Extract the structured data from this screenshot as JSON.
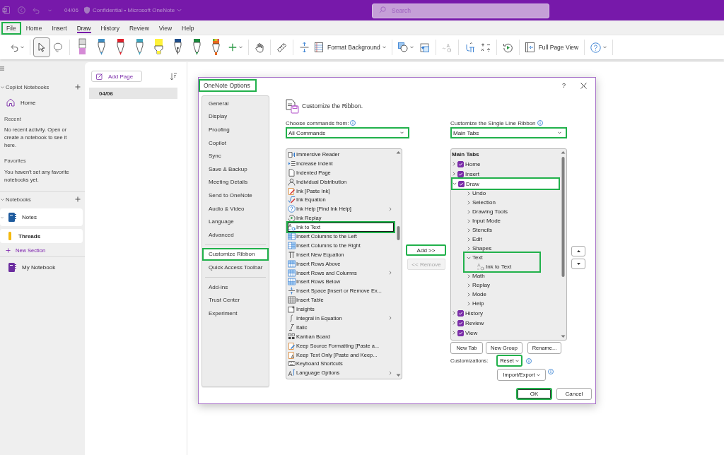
{
  "titlebar": {
    "date": "04/06",
    "title": "Confidential • Microsoft OneNote",
    "search": {
      "placeholder": "Search"
    }
  },
  "menu": [
    {
      "label": "File",
      "selected": false,
      "highlighted": true
    },
    {
      "label": "Home",
      "selected": false,
      "highlighted": false
    },
    {
      "label": "Insert",
      "selected": false,
      "highlighted": false
    },
    {
      "label": "Draw",
      "selected": true,
      "highlighted": false
    },
    {
      "label": "History",
      "selected": false,
      "highlighted": false
    },
    {
      "label": "Review",
      "selected": false,
      "highlighted": false
    },
    {
      "label": "View",
      "selected": false,
      "highlighted": false
    },
    {
      "label": "Help",
      "selected": false,
      "highlighted": false
    }
  ],
  "toolbar": {
    "groups": [
      [
        {
          "kind": "undo"
        }
      ],
      [
        {
          "kind": "pointer",
          "selected": true
        },
        {
          "kind": "lasso",
          "selected": false
        }
      ],
      [
        {
          "kind": "eraser",
          "color": "#d58ad6"
        },
        {
          "kind": "pen",
          "color": "#3f8fc4"
        },
        {
          "kind": "pen",
          "color": "#e3202b"
        },
        {
          "kind": "pen",
          "color": "#41a6bf"
        },
        {
          "kind": "highlighter",
          "color": "#fff23a"
        },
        {
          "kind": "fountain",
          "color": "#1f4e8c"
        },
        {
          "kind": "pen",
          "color": "#1c8a3e"
        },
        {
          "kind": "rainbow",
          "color": "#e8681e"
        },
        {
          "kind": "add-pen"
        }
      ],
      [
        {
          "kind": "hand"
        }
      ],
      [
        {
          "kind": "ruler"
        }
      ],
      [
        {
          "kind": "insert-space"
        },
        {
          "kind": "format-background",
          "label": "Format Background"
        }
      ],
      [
        {
          "kind": "shapes"
        },
        {
          "kind": "ink-to-shape"
        }
      ],
      [
        {
          "kind": "ink-to-text",
          "disabled": true
        }
      ],
      [
        {
          "kind": "ink-to-math"
        },
        {
          "kind": "math"
        }
      ],
      [
        {
          "kind": "replay"
        }
      ],
      [
        {
          "kind": "full-page",
          "label": "Full Page View"
        }
      ],
      [
        {
          "kind": "help"
        }
      ]
    ]
  },
  "sidebar": {
    "copilot": {
      "title": "Copilot Notebooks",
      "expanded": true,
      "home": "Home"
    },
    "recent": {
      "heading": "Recent",
      "text": "No recent activity. Open or create a notebook to see it here."
    },
    "favorites": {
      "heading": "Favorites",
      "text": "You haven't set any favorite notebooks yet."
    },
    "notebooks": {
      "title": "Notebooks",
      "expanded": true,
      "items": [
        {
          "name": "Notes",
          "color": "#1e5b9e",
          "expanded": true,
          "selected": true,
          "sections": [
            {
              "name": "Threads",
              "color": "#f4b90d",
              "selected": true
            }
          ],
          "new_section": "New Section"
        },
        {
          "name": "My Notebook",
          "color": "#6b2d9f",
          "expanded": false,
          "selected": false
        }
      ]
    }
  },
  "pages": {
    "add_page": "Add Page",
    "items": [
      {
        "title": "04/06",
        "selected": true
      }
    ]
  },
  "dialog": {
    "title": "OneNote Options",
    "title_highlighted": true,
    "help": "?",
    "nav": [
      [
        {
          "label": "General",
          "selected": false,
          "highlighted": false
        },
        {
          "label": "Display",
          "selected": false,
          "highlighted": false
        },
        {
          "label": "Proofing",
          "selected": false,
          "highlighted": false
        },
        {
          "label": "Copilot",
          "selected": false,
          "highlighted": false
        },
        {
          "label": "Sync",
          "selected": false,
          "highlighted": false
        },
        {
          "label": "Save & Backup",
          "selected": false,
          "highlighted": false
        },
        {
          "label": "Meeting Details",
          "selected": false,
          "highlighted": false
        },
        {
          "label": "Send to OneNote",
          "selected": false,
          "highlighted": false
        },
        {
          "label": "Audio & Video",
          "selected": false,
          "highlighted": false
        },
        {
          "label": "Language",
          "selected": false,
          "highlighted": false
        },
        {
          "label": "Advanced",
          "selected": false,
          "highlighted": false
        }
      ],
      [
        {
          "label": "Customize Ribbon",
          "selected": true,
          "highlighted": true
        },
        {
          "label": "Quick Access Toolbar",
          "selected": false,
          "highlighted": false
        }
      ],
      [
        {
          "label": "Add-ins",
          "selected": false,
          "highlighted": false
        },
        {
          "label": "Trust Center",
          "selected": false,
          "highlighted": false
        },
        {
          "label": "Experiment",
          "selected": false,
          "highlighted": false
        }
      ]
    ],
    "heading": "Customize the Ribbon.",
    "commands": {
      "label": "Choose commands from:",
      "source": "All Commands",
      "source_highlighted": true,
      "items": [
        {
          "label": "Immersive Reader",
          "kind": "reader",
          "submenu": false,
          "selected": false,
          "highlighted": false
        },
        {
          "label": "Increase Indent",
          "kind": "indent",
          "submenu": false,
          "selected": false,
          "highlighted": false
        },
        {
          "label": "Indented Page",
          "kind": "page",
          "submenu": false,
          "selected": false,
          "highlighted": false
        },
        {
          "label": "Individual Distribution",
          "kind": "person",
          "submenu": false,
          "selected": false,
          "highlighted": false
        },
        {
          "label": "Ink [Paste Ink]",
          "kind": "ink-paste",
          "submenu": false,
          "selected": false,
          "highlighted": false
        },
        {
          "label": "Ink Equation",
          "kind": "ink-equation",
          "submenu": false,
          "selected": false,
          "highlighted": false
        },
        {
          "label": "Ink Help [Find Ink Help]",
          "kind": "help",
          "submenu": true,
          "selected": false,
          "highlighted": false
        },
        {
          "label": "Ink Replay",
          "kind": "replay",
          "submenu": false,
          "selected": false,
          "highlighted": false
        },
        {
          "label": "Ink to Text",
          "kind": "ink-text",
          "submenu": false,
          "selected": true,
          "highlighted": true
        },
        {
          "label": "Insert Columns to the Left",
          "kind": "columns-left",
          "submenu": false,
          "selected": false,
          "highlighted": false
        },
        {
          "label": "Insert Columns to the Right",
          "kind": "columns-right",
          "submenu": false,
          "selected": false,
          "highlighted": false
        },
        {
          "label": "Insert New Equation",
          "kind": "equation",
          "submenu": false,
          "selected": false,
          "highlighted": false
        },
        {
          "label": "Insert Rows Above",
          "kind": "rows-above",
          "submenu": false,
          "selected": false,
          "highlighted": false
        },
        {
          "label": "Insert Rows and Columns",
          "kind": "rows-columns",
          "submenu": true,
          "selected": false,
          "highlighted": false
        },
        {
          "label": "Insert Rows Below",
          "kind": "rows-below",
          "submenu": false,
          "selected": false,
          "highlighted": false
        },
        {
          "label": "Insert Space [Insert or Remove Ex...",
          "kind": "space",
          "submenu": false,
          "selected": false,
          "highlighted": false
        },
        {
          "label": "Insert Table",
          "kind": "table",
          "submenu": false,
          "selected": false,
          "highlighted": false
        },
        {
          "label": "Insights",
          "kind": "insights",
          "submenu": false,
          "selected": false,
          "highlighted": false
        },
        {
          "label": "Integral in Equation",
          "kind": "integral",
          "submenu": true,
          "selected": false,
          "highlighted": false
        },
        {
          "label": "Italic",
          "kind": "italic",
          "submenu": false,
          "selected": false,
          "highlighted": false
        },
        {
          "label": "Kanban Board",
          "kind": "kanban",
          "submenu": false,
          "selected": false,
          "highlighted": false
        },
        {
          "label": "Keep Source Formatting [Paste a...",
          "kind": "paste-format",
          "submenu": false,
          "selected": false,
          "highlighted": false
        },
        {
          "label": "Keep Text Only [Paste and Keep...",
          "kind": "paste-text",
          "submenu": false,
          "selected": false,
          "highlighted": false
        },
        {
          "label": "Keyboard Shortcuts",
          "kind": "keyboard",
          "submenu": false,
          "selected": false,
          "highlighted": false
        },
        {
          "label": "Language Options",
          "kind": "language",
          "submenu": true,
          "selected": false,
          "highlighted": false
        }
      ]
    },
    "add": {
      "label": "Add >>",
      "disabled": false,
      "highlighted": true
    },
    "remove": {
      "label": "<< Remove",
      "disabled": true,
      "highlighted": false
    },
    "ribbon": {
      "label": "Customize the Single Line Ribbon",
      "target": "Main Tabs",
      "target_highlighted": true,
      "header": "Main Tabs",
      "tree": [
        {
          "label": "Home",
          "kind": "tab",
          "checked": true,
          "expanded": false,
          "selected": false,
          "highlighted": false
        },
        {
          "label": "Insert",
          "kind": "tab",
          "checked": true,
          "expanded": false,
          "selected": false,
          "highlighted": false
        },
        {
          "label": "Draw",
          "kind": "tab",
          "checked": true,
          "expanded": true,
          "selected": true,
          "highlighted": true,
          "children": [
            {
              "label": "Undo",
              "kind": "group",
              "expanded": false,
              "selected": false,
              "highlighted": false
            },
            {
              "label": "Selection",
              "kind": "group",
              "expanded": false,
              "selected": false,
              "highlighted": false
            },
            {
              "label": "Drawing Tools",
              "kind": "group",
              "expanded": false,
              "selected": false,
              "highlighted": false
            },
            {
              "label": "Input Mode",
              "kind": "group",
              "expanded": false,
              "selected": false,
              "highlighted": false
            },
            {
              "label": "Stencils",
              "kind": "group",
              "expanded": false,
              "selected": false,
              "highlighted": false
            },
            {
              "label": "Edit",
              "kind": "group",
              "expanded": false,
              "selected": false,
              "highlighted": false
            },
            {
              "label": "Shapes",
              "kind": "group",
              "expanded": false,
              "selected": false,
              "highlighted": false
            },
            {
              "label": "Text",
              "kind": "group",
              "expanded": true,
              "selected": false,
              "highlighted": true,
              "children": [
                {
                  "label": "Ink to Text",
                  "kind": "command",
                  "selected": false,
                  "highlighted": false
                }
              ]
            },
            {
              "label": "Math",
              "kind": "group",
              "expanded": false,
              "selected": false,
              "highlighted": false
            },
            {
              "label": "Replay",
              "kind": "group",
              "expanded": false,
              "selected": false,
              "highlighted": false
            },
            {
              "label": "Mode",
              "kind": "group",
              "expanded": false,
              "selected": false,
              "highlighted": false
            },
            {
              "label": "Help",
              "kind": "group",
              "expanded": false,
              "selected": false,
              "highlighted": false
            }
          ]
        },
        {
          "label": "History",
          "kind": "tab",
          "checked": true,
          "expanded": false,
          "selected": false,
          "highlighted": false
        },
        {
          "label": "Review",
          "kind": "tab",
          "checked": true,
          "expanded": false,
          "selected": false,
          "highlighted": false
        },
        {
          "label": "View",
          "kind": "tab",
          "checked": true,
          "expanded": false,
          "selected": false,
          "highlighted": false
        }
      ]
    },
    "tree_buttons": [
      {
        "label": "New Tab"
      },
      {
        "label": "New Group"
      },
      {
        "label": "Rename..."
      }
    ],
    "customizations": {
      "label": "Customizations:",
      "reset": {
        "label": "Reset",
        "highlighted": true
      },
      "import_export": {
        "label": "Import/Export",
        "highlighted": false
      }
    },
    "footer": [
      {
        "label": "OK",
        "kind": "default",
        "highlighted": true
      },
      {
        "label": "Cancel",
        "kind": "normal",
        "highlighted": false
      }
    ]
  }
}
